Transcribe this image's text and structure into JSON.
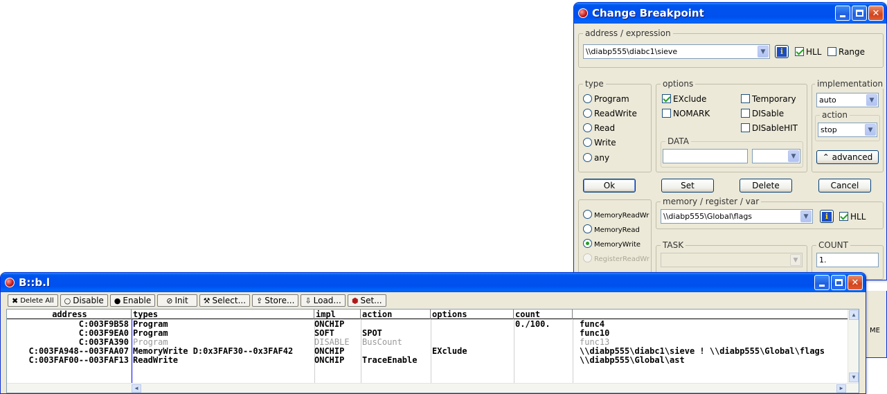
{
  "dialog": {
    "title": "Change Breakpoint",
    "address_group": {
      "label": "address / expression",
      "value": "\\\\diabp555\\diabc1\\sieve",
      "hll_label": "HLL",
      "hll_checked": true,
      "range_label": "Range",
      "range_checked": false
    },
    "type_group": {
      "label": "type",
      "options": [
        "Program",
        "ReadWrite",
        "Read",
        "Write",
        "any"
      ]
    },
    "options_group": {
      "label": "options",
      "exclude": "EXclude",
      "temporary": "Temporary",
      "nomark": "NOMARK",
      "disable": "DISable",
      "disablehit": "DISableHIT",
      "data_label": "DATA"
    },
    "implementation_group": {
      "label": "implementation",
      "value": "auto",
      "action_label": "action",
      "action_value": "stop",
      "advanced_label": "advanced"
    },
    "buttons": {
      "ok": "Ok",
      "set": "Set",
      "delete": "Delete",
      "cancel": "Cancel"
    },
    "memory_group": {
      "label": "memory / register / var",
      "value": "\\\\diabp555\\Global\\flags",
      "hll_label": "HLL",
      "hll_checked": true
    },
    "memory_types": [
      "MemoryReadWr",
      "MemoryRead",
      "MemoryWrite",
      "RegisterReadWr"
    ],
    "selected_memory_type": "MemoryWrite",
    "task_label": "TASK",
    "count_label": "COUNT",
    "count_value": "1.",
    "clipped_text": "ME"
  },
  "breaklist": {
    "title": "B::b.l",
    "toolbar": {
      "delete_all": "Delete All",
      "disable": "Disable",
      "enable": "Enable",
      "init": "Init",
      "select": "Select...",
      "store": "Store...",
      "load": "Load...",
      "set": "Set..."
    },
    "columns": [
      "address",
      "types",
      "impl",
      "action",
      "options",
      "count"
    ],
    "rows": [
      {
        "address": "C:003F9B58",
        "types": "Program",
        "impl": "ONCHIP",
        "action": "",
        "options": "",
        "count": "0./100.",
        "symbol": "func4",
        "disabled": false
      },
      {
        "address": "C:003F9EA0",
        "types": "Program",
        "impl": "SOFT",
        "action": "SPOT",
        "options": "",
        "count": "",
        "symbol": "func10",
        "disabled": false
      },
      {
        "address": "C:003FA390",
        "types": "Program",
        "impl": "DISABLE",
        "action": "BusCount",
        "options": "",
        "count": "",
        "symbol": "func13",
        "disabled": true
      },
      {
        "address": "C:003FA948--003FAA07",
        "types": "MemoryWrite D:0x3FAF30--0x3FAF42",
        "impl": "ONCHIP",
        "action": "",
        "options": "EXclude",
        "count": "",
        "symbol": "\\\\diabp555\\diabc1\\sieve ! \\\\diabp555\\Global\\flags",
        "disabled": false
      },
      {
        "address": "C:003FAF00--003FAF13",
        "types": "ReadWrite",
        "impl": "ONCHIP",
        "action": "TraceEnable",
        "options": "",
        "count": "",
        "symbol": "\\\\diabp555\\Global\\ast",
        "disabled": false
      }
    ]
  }
}
